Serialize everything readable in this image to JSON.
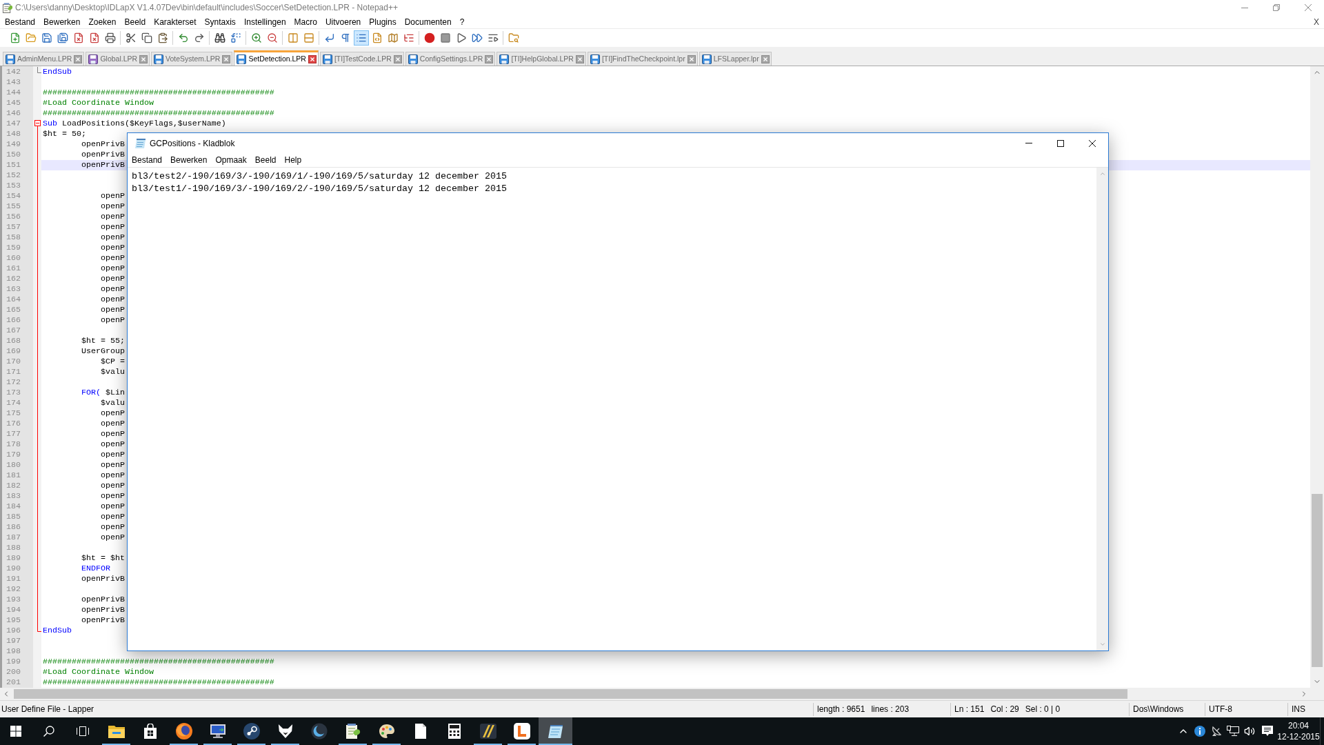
{
  "window": {
    "title": "C:\\Users\\danny\\Desktop\\IDLapX V1.4.07Dev\\bin\\default\\includes\\Soccer\\SetDetection.LPR - Notepad++"
  },
  "menu_bar": {
    "items": [
      "Bestand",
      "Bewerken",
      "Zoeken",
      "Beeld",
      "Karakterset",
      "Syntaxis",
      "Instellingen",
      "Macro",
      "Uitvoeren",
      "Plugins",
      "Documenten",
      "?"
    ],
    "close": "X"
  },
  "toolbar": [
    {
      "kind": "new",
      "on": false
    },
    {
      "kind": "open",
      "on": false
    },
    {
      "kind": "save",
      "on": false
    },
    {
      "kind": "save-all",
      "on": false
    },
    {
      "kind": "close",
      "on": false
    },
    {
      "kind": "close-all",
      "on": false
    },
    {
      "kind": "print",
      "on": false
    },
    {
      "kind": "separator"
    },
    {
      "kind": "cut",
      "on": false
    },
    {
      "kind": "copy",
      "on": false
    },
    {
      "kind": "paste",
      "on": false
    },
    {
      "kind": "separator"
    },
    {
      "kind": "undo",
      "on": false
    },
    {
      "kind": "redo",
      "on": false
    },
    {
      "kind": "separator"
    },
    {
      "kind": "find",
      "on": false
    },
    {
      "kind": "replace",
      "on": false
    },
    {
      "kind": "separator"
    },
    {
      "kind": "zoom-in",
      "on": false
    },
    {
      "kind": "zoom-out",
      "on": false
    },
    {
      "kind": "separator"
    },
    {
      "kind": "sync-vertical",
      "on": false
    },
    {
      "kind": "sync-horizontal",
      "on": false
    },
    {
      "kind": "separator"
    },
    {
      "kind": "word-wrap",
      "on": false
    },
    {
      "kind": "show-all",
      "on": false
    },
    {
      "kind": "indent-guide",
      "on": true
    },
    {
      "kind": "user-language",
      "on": false
    },
    {
      "kind": "document-map",
      "on": false
    },
    {
      "kind": "function-list",
      "on": false
    },
    {
      "kind": "separator"
    },
    {
      "kind": "record",
      "on": false
    },
    {
      "kind": "stop",
      "on": false
    },
    {
      "kind": "play",
      "on": false
    },
    {
      "kind": "play-multiple",
      "on": false
    },
    {
      "kind": "save-macro",
      "on": false
    },
    {
      "kind": "separator"
    },
    {
      "kind": "run",
      "on": false
    }
  ],
  "tabs": [
    {
      "label": "AdminMenu.LPR",
      "selected": false,
      "read_only": false
    },
    {
      "label": "Global.LPR",
      "selected": false,
      "read_only": true
    },
    {
      "label": "VoteSystem.LPR",
      "selected": false,
      "read_only": false
    },
    {
      "label": "SetDetection.LPR",
      "selected": true,
      "read_only": false
    },
    {
      "label": "[TI]TestCode.LPR",
      "selected": false,
      "read_only": false
    },
    {
      "label": "ConfigSettings.LPR",
      "selected": false,
      "read_only": false
    },
    {
      "label": "[TI]HelpGlobal.LPR",
      "selected": false,
      "read_only": false
    },
    {
      "label": "[TI]FindTheCheckpoint.lpr",
      "selected": false,
      "read_only": false
    },
    {
      "label": "LFSLapper.lpr",
      "selected": false,
      "read_only": false
    }
  ],
  "editor": {
    "lines": [
      {
        "number": "142",
        "kind": "fold-end",
        "fold_active": false,
        "current": false,
        "segments": [
          {
            "kind": "keyword",
            "text": "EndSub"
          }
        ]
      },
      {
        "number": "143",
        "kind": "plain",
        "current": false
      },
      {
        "number": "144",
        "kind": "plain",
        "current": false,
        "segments": [
          {
            "kind": "comment",
            "text": "################################################"
          }
        ]
      },
      {
        "number": "145",
        "kind": "plain",
        "current": false,
        "segments": [
          {
            "kind": "comment",
            "text": "#Load Coordinate Window"
          }
        ]
      },
      {
        "number": "146",
        "kind": "plain",
        "current": false,
        "segments": [
          {
            "kind": "comment",
            "text": "################################################"
          }
        ]
      },
      {
        "number": "147",
        "kind": "fold-start",
        "fold_active": true,
        "current": false,
        "segments": [
          {
            "kind": "keyword",
            "text": "Sub"
          },
          {
            "kind": "plain",
            "text": " LoadPositions($KeyFlags,$userName)"
          }
        ]
      },
      {
        "number": "148",
        "kind": "fold-body",
        "fold_active": true,
        "current": false,
        "segments": [
          {
            "kind": "plain",
            "text": "$ht = 50;"
          }
        ]
      },
      {
        "number": "149",
        "kind": "fold-body",
        "fold_active": true,
        "current": false,
        "segments": [
          {
            "kind": "plain",
            "text": "        openPrivB"
          }
        ]
      },
      {
        "number": "150",
        "kind": "fold-body",
        "fold_active": true,
        "current": false,
        "segments": [
          {
            "kind": "plain",
            "text": "        openPrivB"
          }
        ]
      },
      {
        "number": "151",
        "kind": "fold-body",
        "fold_active": true,
        "current": true,
        "segments": [
          {
            "kind": "plain",
            "text": "        openPrivB"
          }
        ]
      },
      {
        "number": "152",
        "kind": "fold-body",
        "fold_active": true,
        "current": false
      },
      {
        "number": "153",
        "kind": "fold-body",
        "fold_active": true,
        "current": false
      },
      {
        "number": "154",
        "kind": "fold-body",
        "fold_active": true,
        "current": false,
        "segments": [
          {
            "kind": "plain",
            "text": "            openP"
          }
        ]
      },
      {
        "number": "155",
        "kind": "fold-body",
        "fold_active": true,
        "current": false,
        "segments": [
          {
            "kind": "plain",
            "text": "            openP"
          }
        ]
      },
      {
        "number": "156",
        "kind": "fold-body",
        "fold_active": true,
        "current": false,
        "segments": [
          {
            "kind": "plain",
            "text": "            openP"
          }
        ]
      },
      {
        "number": "157",
        "kind": "fold-body",
        "fold_active": true,
        "current": false,
        "segments": [
          {
            "kind": "plain",
            "text": "            openP"
          }
        ]
      },
      {
        "number": "158",
        "kind": "fold-body",
        "fold_active": true,
        "current": false,
        "segments": [
          {
            "kind": "plain",
            "text": "            openP"
          }
        ]
      },
      {
        "number": "159",
        "kind": "fold-body",
        "fold_active": true,
        "current": false,
        "segments": [
          {
            "kind": "plain",
            "text": "            openP"
          }
        ]
      },
      {
        "number": "160",
        "kind": "fold-body",
        "fold_active": true,
        "current": false,
        "segments": [
          {
            "kind": "plain",
            "text": "            openP"
          }
        ]
      },
      {
        "number": "161",
        "kind": "fold-body",
        "fold_active": true,
        "current": false,
        "segments": [
          {
            "kind": "plain",
            "text": "            openP"
          }
        ]
      },
      {
        "number": "162",
        "kind": "fold-body",
        "fold_active": true,
        "current": false,
        "segments": [
          {
            "kind": "plain",
            "text": "            openP"
          }
        ]
      },
      {
        "number": "163",
        "kind": "fold-body",
        "fold_active": true,
        "current": false,
        "segments": [
          {
            "kind": "plain",
            "text": "            openP"
          }
        ]
      },
      {
        "number": "164",
        "kind": "fold-body",
        "fold_active": true,
        "current": false,
        "segments": [
          {
            "kind": "plain",
            "text": "            openP"
          }
        ]
      },
      {
        "number": "165",
        "kind": "fold-body",
        "fold_active": true,
        "current": false,
        "segments": [
          {
            "kind": "plain",
            "text": "            openP"
          }
        ]
      },
      {
        "number": "166",
        "kind": "fold-body",
        "fold_active": true,
        "current": false,
        "segments": [
          {
            "kind": "plain",
            "text": "            openP"
          }
        ]
      },
      {
        "number": "167",
        "kind": "fold-body",
        "fold_active": true,
        "current": false
      },
      {
        "number": "168",
        "kind": "fold-body",
        "fold_active": true,
        "current": false,
        "segments": [
          {
            "kind": "plain",
            "text": "        $ht = 55;"
          }
        ]
      },
      {
        "number": "169",
        "kind": "fold-body",
        "fold_active": true,
        "current": false,
        "segments": [
          {
            "kind": "plain",
            "text": "        UserGroup"
          }
        ]
      },
      {
        "number": "170",
        "kind": "fold-body",
        "fold_active": true,
        "current": false,
        "segments": [
          {
            "kind": "plain",
            "text": "            $CP ="
          }
        ]
      },
      {
        "number": "171",
        "kind": "fold-body",
        "fold_active": true,
        "current": false,
        "segments": [
          {
            "kind": "plain",
            "text": "            $valu"
          }
        ]
      },
      {
        "number": "172",
        "kind": "fold-body",
        "fold_active": true,
        "current": false
      },
      {
        "number": "173",
        "kind": "fold-body",
        "fold_active": true,
        "current": false,
        "segments": [
          {
            "kind": "keyword",
            "text": "        FOR("
          },
          {
            "kind": "plain",
            "text": " $Lin"
          }
        ]
      },
      {
        "number": "174",
        "kind": "fold-body",
        "fold_active": true,
        "current": false,
        "segments": [
          {
            "kind": "plain",
            "text": "            $valu"
          }
        ]
      },
      {
        "number": "175",
        "kind": "fold-body",
        "fold_active": true,
        "current": false,
        "segments": [
          {
            "kind": "plain",
            "text": "            openP"
          }
        ]
      },
      {
        "number": "176",
        "kind": "fold-body",
        "fold_active": true,
        "current": false,
        "segments": [
          {
            "kind": "plain",
            "text": "            openP"
          }
        ]
      },
      {
        "number": "177",
        "kind": "fold-body",
        "fold_active": true,
        "current": false,
        "segments": [
          {
            "kind": "plain",
            "text": "            openP"
          }
        ]
      },
      {
        "number": "178",
        "kind": "fold-body",
        "fold_active": true,
        "current": false,
        "segments": [
          {
            "kind": "plain",
            "text": "            openP"
          }
        ]
      },
      {
        "number": "179",
        "kind": "fold-body",
        "fold_active": true,
        "current": false,
        "segments": [
          {
            "kind": "plain",
            "text": "            openP"
          }
        ]
      },
      {
        "number": "180",
        "kind": "fold-body",
        "fold_active": true,
        "current": false,
        "segments": [
          {
            "kind": "plain",
            "text": "            openP"
          }
        ]
      },
      {
        "number": "181",
        "kind": "fold-body",
        "fold_active": true,
        "current": false,
        "segments": [
          {
            "kind": "plain",
            "text": "            openP"
          }
        ]
      },
      {
        "number": "182",
        "kind": "fold-body",
        "fold_active": true,
        "current": false,
        "segments": [
          {
            "kind": "plain",
            "text": "            openP"
          }
        ]
      },
      {
        "number": "183",
        "kind": "fold-body",
        "fold_active": true,
        "current": false,
        "segments": [
          {
            "kind": "plain",
            "text": "            openP"
          }
        ]
      },
      {
        "number": "184",
        "kind": "fold-body",
        "fold_active": true,
        "current": false,
        "segments": [
          {
            "kind": "plain",
            "text": "            openP"
          }
        ]
      },
      {
        "number": "185",
        "kind": "fold-body",
        "fold_active": true,
        "current": false,
        "segments": [
          {
            "kind": "plain",
            "text": "            openP"
          }
        ]
      },
      {
        "number": "186",
        "kind": "fold-body",
        "fold_active": true,
        "current": false,
        "segments": [
          {
            "kind": "plain",
            "text": "            openP"
          }
        ]
      },
      {
        "number": "187",
        "kind": "fold-body",
        "fold_active": true,
        "current": false,
        "segments": [
          {
            "kind": "plain",
            "text": "            openP"
          }
        ]
      },
      {
        "number": "188",
        "kind": "fold-body",
        "fold_active": true,
        "current": false
      },
      {
        "number": "189",
        "kind": "fold-body",
        "fold_active": true,
        "current": false,
        "segments": [
          {
            "kind": "plain",
            "text": "        $ht = $ht"
          }
        ]
      },
      {
        "number": "190",
        "kind": "fold-body",
        "fold_active": true,
        "current": false,
        "segments": [
          {
            "kind": "keyword",
            "text": "        ENDFOR"
          }
        ]
      },
      {
        "number": "191",
        "kind": "fold-body",
        "fold_active": true,
        "current": false,
        "segments": [
          {
            "kind": "plain",
            "text": "        openPrivB"
          }
        ]
      },
      {
        "number": "192",
        "kind": "fold-body",
        "fold_active": true,
        "current": false
      },
      {
        "number": "193",
        "kind": "fold-body",
        "fold_active": true,
        "current": false,
        "segments": [
          {
            "kind": "plain",
            "text": "        openPrivB"
          }
        ]
      },
      {
        "number": "194",
        "kind": "fold-body",
        "fold_active": true,
        "current": false,
        "segments": [
          {
            "kind": "plain",
            "text": "        openPrivB"
          }
        ]
      },
      {
        "number": "195",
        "kind": "fold-body",
        "fold_active": true,
        "current": false,
        "segments": [
          {
            "kind": "plain",
            "text": "        openPrivB"
          }
        ]
      },
      {
        "number": "196",
        "kind": "fold-end",
        "fold_active": true,
        "current": false,
        "segments": [
          {
            "kind": "keyword",
            "text": "EndSub"
          }
        ]
      },
      {
        "number": "197",
        "kind": "plain",
        "current": false
      },
      {
        "number": "198",
        "kind": "plain",
        "current": false
      },
      {
        "number": "199",
        "kind": "plain",
        "current": false,
        "segments": [
          {
            "kind": "comment",
            "text": "################################################"
          }
        ]
      },
      {
        "number": "200",
        "kind": "plain",
        "current": false,
        "segments": [
          {
            "kind": "comment",
            "text": "#Load Coordinate Window"
          }
        ]
      },
      {
        "number": "201",
        "kind": "plain",
        "current": false,
        "segments": [
          {
            "kind": "comment",
            "text": "################################################"
          }
        ]
      }
    ]
  },
  "status_bar": {
    "segments": [
      {
        "texts": [
          "User Define File - Lapper"
        ]
      },
      {
        "texts": [
          "length : 9651",
          "lines : 203"
        ]
      },
      {
        "texts": [
          "Ln : 151",
          "Col : 29",
          "Sel : 0 | 0"
        ]
      },
      {
        "texts": [
          "Dos\\Windows"
        ]
      },
      {
        "texts": [
          "UTF-8"
        ]
      },
      {
        "texts": [
          "INS"
        ]
      }
    ]
  },
  "taskbar": {
    "apps": [
      {
        "kind": "explorer",
        "running": true,
        "active": false
      },
      {
        "kind": "store",
        "running": false,
        "active": false
      },
      {
        "kind": "firefox",
        "running": true,
        "active": false
      },
      {
        "kind": "monitor",
        "running": true,
        "active": false
      },
      {
        "kind": "steam",
        "running": true,
        "active": false
      },
      {
        "kind": "fox",
        "running": true,
        "active": false
      },
      {
        "kind": "orb",
        "running": false,
        "active": false
      },
      {
        "kind": "notepadpp",
        "running": true,
        "active": false
      },
      {
        "kind": "paint",
        "running": true,
        "active": false
      },
      {
        "kind": "document",
        "running": false,
        "active": false
      },
      {
        "kind": "calculator",
        "running": false,
        "active": false
      },
      {
        "kind": "stripes",
        "running": true,
        "active": false
      },
      {
        "kind": "hook",
        "running": true,
        "active": false
      },
      {
        "kind": "notepad",
        "running": true,
        "active": true
      }
    ],
    "time": "20:04",
    "date": "12-12-2015"
  },
  "notepad": {
    "title": "GCPositions - Kladblok",
    "menu": [
      "Bestand",
      "Bewerken",
      "Opmaak",
      "Beeld",
      "Help"
    ],
    "lines": [
      "bl3/test2/-190/169/3/-190/169/1/-190/169/5/saturday 12 december 2015",
      "bl3/test1/-190/169/3/-190/169/2/-190/169/5/saturday 12 december 2015"
    ]
  }
}
